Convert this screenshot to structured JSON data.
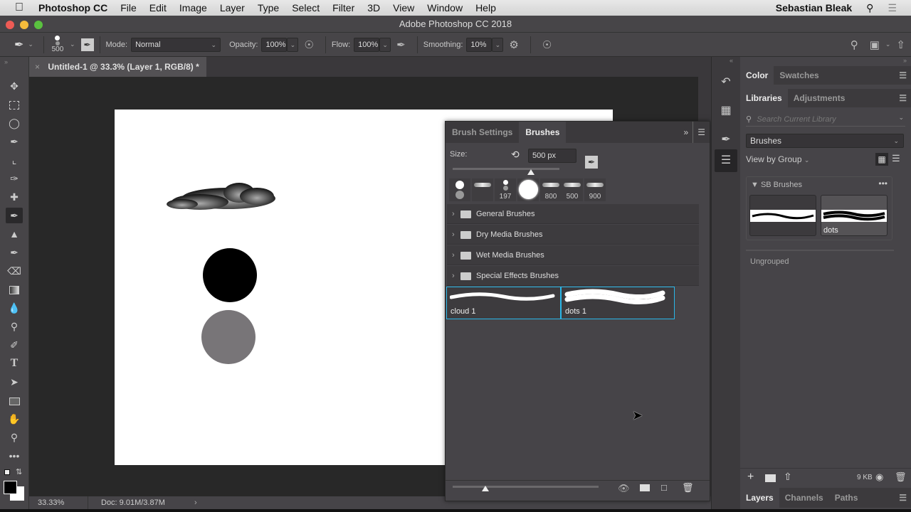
{
  "menubar": {
    "app_name": "Photoshop CC",
    "items": [
      "File",
      "Edit",
      "Image",
      "Layer",
      "Type",
      "Select",
      "Filter",
      "3D",
      "View",
      "Window",
      "Help"
    ],
    "user": "Sebastian Bleak",
    "icons": [
      "search-icon",
      "list-icon"
    ]
  },
  "window": {
    "title": "Adobe Photoshop CC 2018"
  },
  "options_bar": {
    "brush_size": "500",
    "mode_label": "Mode:",
    "mode_value": "Normal",
    "opacity_label": "Opacity:",
    "opacity_value": "100%",
    "flow_label": "Flow:",
    "flow_value": "100%",
    "smoothing_label": "Smoothing:",
    "smoothing_value": "10%"
  },
  "document": {
    "tab_title": "Untitled-1 @ 33.3% (Layer 1, RGB/8) *",
    "zoom": "33.33%",
    "doc_info": "Doc: 9.01M/3.87M"
  },
  "tools": [
    "move",
    "marquee",
    "lasso",
    "quick-select",
    "crop",
    "eyedropper",
    "healing",
    "brush",
    "stamp",
    "history-brush",
    "eraser",
    "gradient",
    "blur",
    "dodge",
    "pen",
    "type",
    "path-select",
    "rectangle",
    "hand",
    "zoom",
    "more"
  ],
  "brushes_panel": {
    "tabs": [
      "Brush Settings",
      "Brushes"
    ],
    "active_tab": "Brushes",
    "size_label": "Size:",
    "size_value": "500 px",
    "size_slider_fraction": 0.7,
    "recent_tips": [
      {
        "kind": "dual-round",
        "label": ""
      },
      {
        "kind": "cloud",
        "label": ""
      },
      {
        "kind": "dual-round-small",
        "label": "197"
      },
      {
        "kind": "soft-round",
        "label": ""
      },
      {
        "kind": "cloud",
        "label": "800"
      },
      {
        "kind": "cloud",
        "label": "500"
      },
      {
        "kind": "cloud",
        "label": "900"
      }
    ],
    "folders": [
      "General Brushes",
      "Dry Media Brushes",
      "Wet Media Brushes",
      "Special Effects Brushes"
    ],
    "presets": [
      {
        "name": "cloud 1"
      },
      {
        "name": "dots 1"
      }
    ]
  },
  "right_panels": {
    "top_tabs": [
      "Color",
      "Swatches"
    ],
    "mid_tabs": [
      "Libraries",
      "Adjustments"
    ],
    "search_placeholder": "Search Current Library",
    "library_select": "Brushes",
    "view_by": "View by Group",
    "group_name": "SB Brushes",
    "group_items": [
      {
        "name": ""
      },
      {
        "name": "dots"
      }
    ],
    "ungrouped": "Ungrouped",
    "storage": "9 KB",
    "bottom_tabs": [
      "Layers",
      "Channels",
      "Paths"
    ]
  },
  "colors": {
    "accent_selection": "#29b6e8",
    "foreground": "#000000",
    "background": "#ffffff"
  }
}
